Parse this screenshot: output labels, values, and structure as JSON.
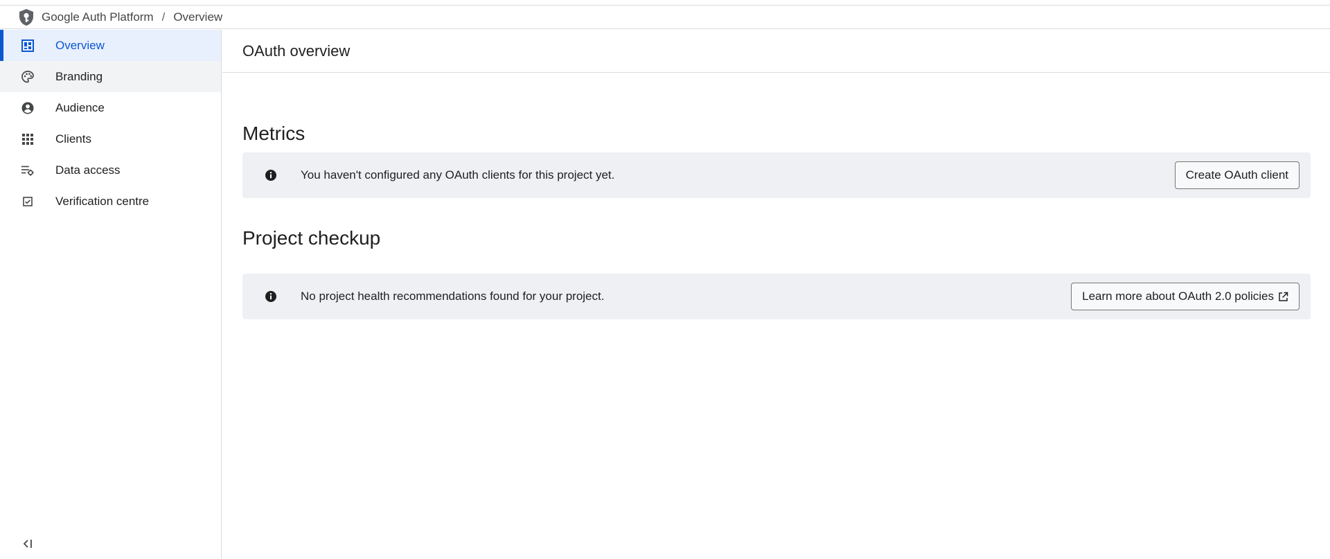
{
  "header": {
    "breadcrumb": [
      "Google Auth Platform",
      "Overview"
    ],
    "separator": "/",
    "logo_icon": "shield-key-icon"
  },
  "sidebar": {
    "items": [
      {
        "label": "Overview",
        "icon": "dashboard-icon",
        "state": "active"
      },
      {
        "label": "Branding",
        "icon": "palette-icon",
        "state": "hover"
      },
      {
        "label": "Audience",
        "icon": "account-circle-icon",
        "state": "normal"
      },
      {
        "label": "Clients",
        "icon": "apps-grid-icon",
        "state": "normal"
      },
      {
        "label": "Data access",
        "icon": "data-settings-icon",
        "state": "normal"
      },
      {
        "label": "Verification centre",
        "icon": "checkbox-icon",
        "state": "normal"
      }
    ],
    "collapse_icon": "collapse-sidebar-icon"
  },
  "main": {
    "page_title": "OAuth overview",
    "metrics": {
      "title": "Metrics",
      "message": "You haven't configured any OAuth clients for this project yet.",
      "button_label": "Create OAuth client"
    },
    "checkup": {
      "title": "Project checkup",
      "message": "No project health recommendations found for your project.",
      "button_label": "Learn more about OAuth 2.0 policies"
    }
  },
  "colors": {
    "accent": "#0b57d0",
    "active_bg": "#e8f0fe",
    "banner_bg": "#eef0f3"
  }
}
